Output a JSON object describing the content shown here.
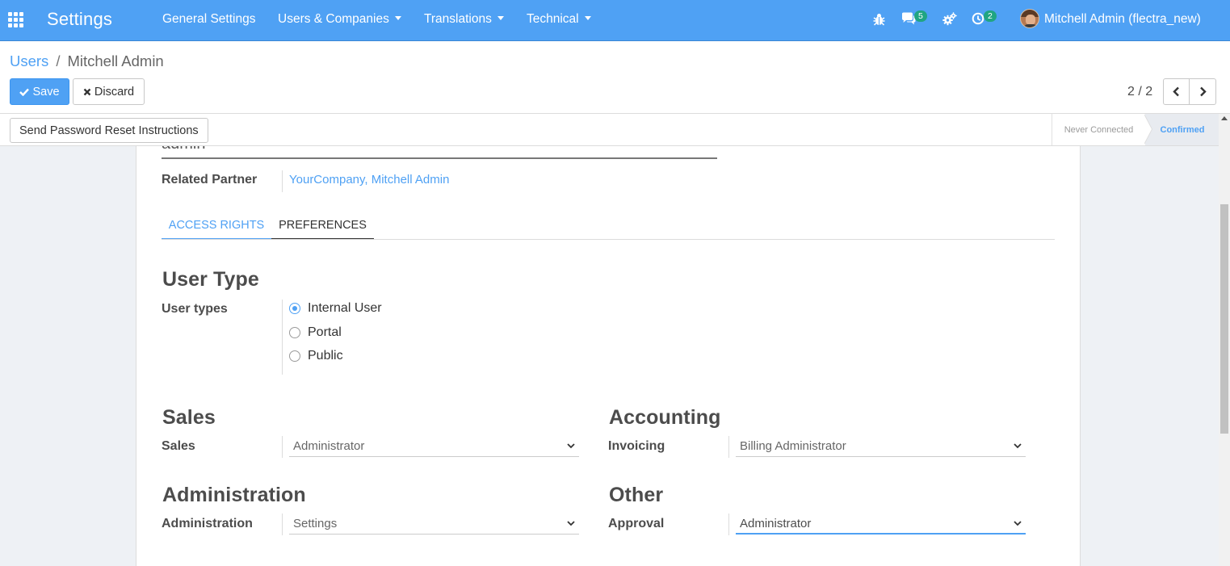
{
  "navbar": {
    "brand": "Settings",
    "menus": [
      "General Settings",
      "Users & Companies",
      "Translations",
      "Technical"
    ],
    "messages_count": "5",
    "activities_count": "2",
    "user": "Mitchell Admin (flectra_new)"
  },
  "breadcrumb": {
    "parent": "Users",
    "separator": "/",
    "current": "Mitchell Admin"
  },
  "buttons": {
    "save": "Save",
    "discard": "Discard",
    "reset_password": "Send Password Reset Instructions"
  },
  "pager": {
    "value": "2 / 2"
  },
  "statusbar": {
    "stages": [
      "Never Connected",
      "Confirmed"
    ],
    "current": "Confirmed"
  },
  "form": {
    "partial_name": "admin",
    "related_partner_label": "Related Partner",
    "related_partner_value": "YourCompany, Mitchell Admin",
    "tabs": [
      "ACCESS RIGHTS",
      "PREFERENCES"
    ],
    "user_type_title": "User Type",
    "user_types_label": "User types",
    "user_types": [
      "Internal User",
      "Portal",
      "Public"
    ],
    "selected_user_type": "Internal User",
    "sales_title": "Sales",
    "sales_label": "Sales",
    "sales_value": "Administrator",
    "accounting_title": "Accounting",
    "invoicing_label": "Invoicing",
    "invoicing_value": "Billing Administrator",
    "administration_title": "Administration",
    "administration_label": "Administration",
    "administration_value": "Settings",
    "other_title": "Other",
    "approval_label": "Approval",
    "approval_value": "Administrator"
  },
  "colors": {
    "navbar": "#4fa1f4",
    "accent": "#4fa1f4",
    "badge": "#20a582"
  }
}
